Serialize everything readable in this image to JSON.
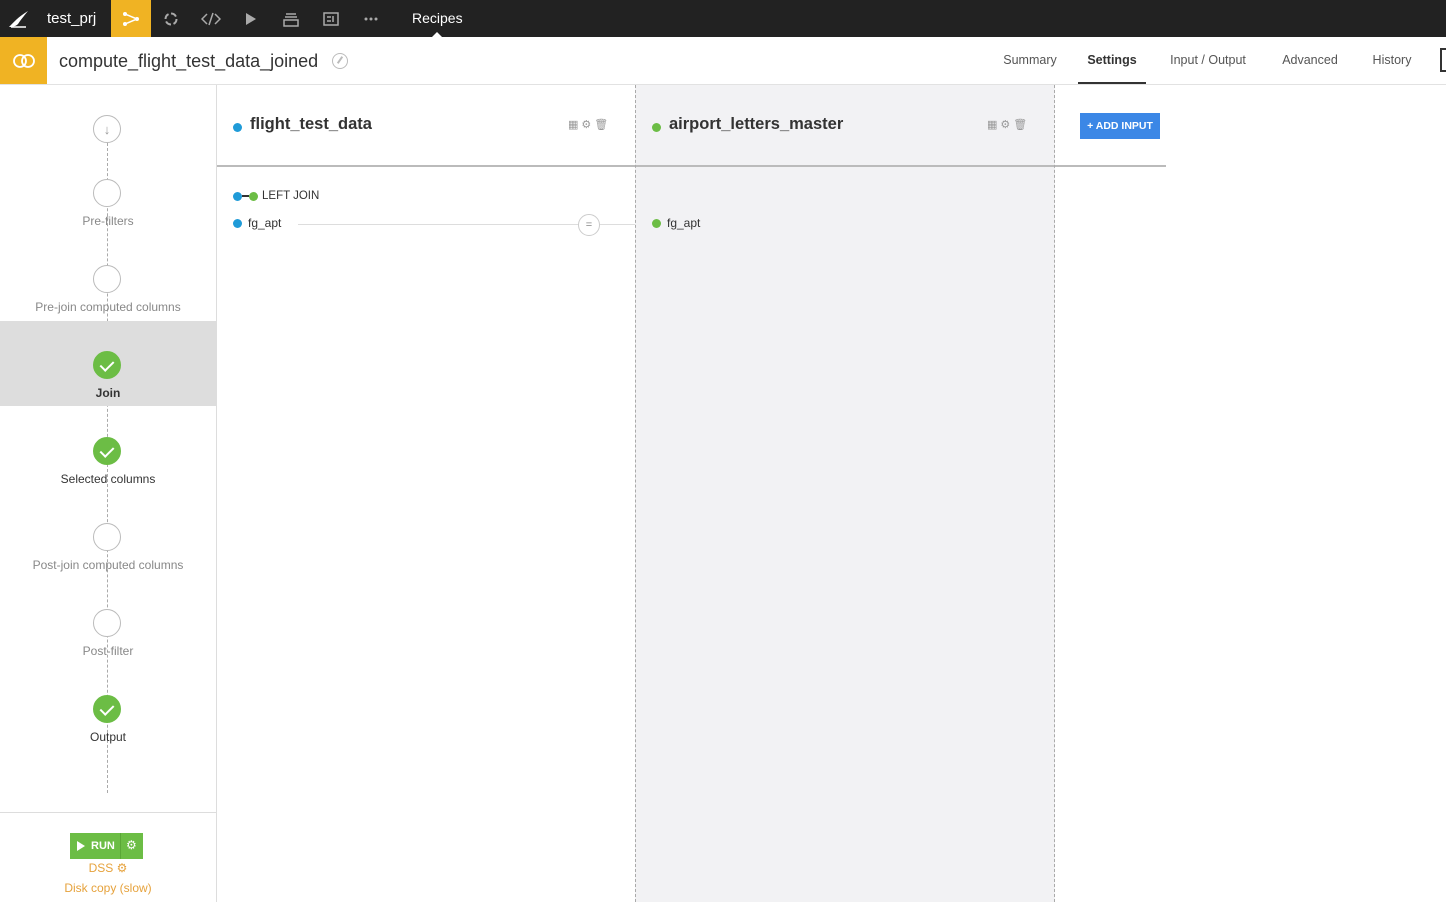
{
  "topbar": {
    "project": "test_prj",
    "section": "Recipes",
    "icons": [
      "bird-logo-icon",
      "flow-icon",
      "cycle-icon",
      "code-icon",
      "run-icon",
      "stack-icon",
      "dashboard-icon",
      "more-icon"
    ]
  },
  "recipe": {
    "name": "compute_flight_test_data_joined",
    "tabs": [
      "Summary",
      "Settings",
      "Input / Output",
      "Advanced",
      "History"
    ],
    "active_tab": "Settings"
  },
  "steps": [
    {
      "label": "Pre-filters",
      "done": false
    },
    {
      "label": "Pre-join computed columns",
      "done": false
    },
    {
      "label": "Join",
      "done": true,
      "selected": true
    },
    {
      "label": "Selected columns",
      "done": true
    },
    {
      "label": "Post-join computed columns",
      "done": false
    },
    {
      "label": "Post-filter",
      "done": false
    },
    {
      "label": "Output",
      "done": true
    }
  ],
  "run": {
    "label": "RUN",
    "engine": "DSS",
    "engine_sub": "Disk copy (slow)"
  },
  "inputs": [
    {
      "name": "flight_test_data",
      "color": "#1f9bd8"
    },
    {
      "name": "airport_letters_master",
      "color": "#6cbd45"
    }
  ],
  "add_input_label": "+ ADD INPUT",
  "join": {
    "type": "LEFT JOIN",
    "operator": "=",
    "left_key": "fg_apt",
    "right_key": "fg_apt"
  },
  "colors": {
    "accent": "#f0b323",
    "success": "#6cbd45",
    "primary": "#3b87e6",
    "left_dataset": "#1f9bd8",
    "right_dataset": "#6cbd45"
  }
}
